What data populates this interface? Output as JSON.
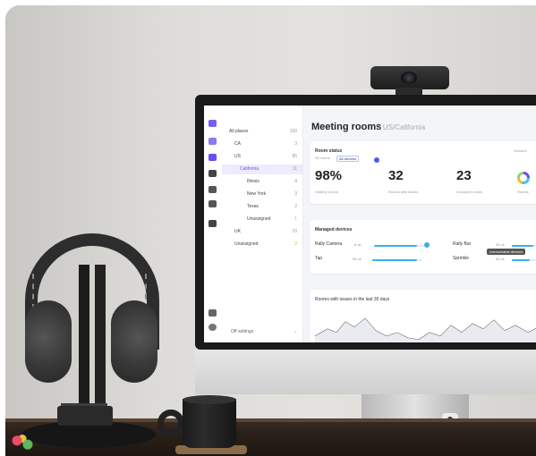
{
  "screen": {
    "page_title": "Meeting rooms",
    "page_location": "- US/California",
    "tree": [
      {
        "label": "All places",
        "count": "100",
        "level": 0
      },
      {
        "label": "CA",
        "count": "3",
        "level": 1
      },
      {
        "label": "US",
        "count": "85",
        "level": 1
      },
      {
        "label": "California",
        "count": "11",
        "level": 2
      },
      {
        "label": "Illinois",
        "count": "4",
        "level": 3
      },
      {
        "label": "New York",
        "count": "3",
        "level": 3
      },
      {
        "label": "Texas",
        "count": "2",
        "level": 3
      },
      {
        "label": "Unassigned",
        "count": "1",
        "level": 3
      },
      {
        "label": "UK",
        "count": "10",
        "level": 1
      },
      {
        "label": "Unassigned",
        "count": "2",
        "level": 1
      }
    ],
    "footer_link": "Off settings",
    "room_status": {
      "title": "Room status",
      "subtitle": "All rooms",
      "tooltip": "All devices",
      "side_label": "Sensors",
      "stats": [
        {
          "value": "98%",
          "label": "Healthy rooms"
        },
        {
          "value": "32",
          "label": "Rooms with issues"
        },
        {
          "value": "23",
          "label": "Occupied rooms"
        }
      ],
      "donut_label": "Rooms"
    },
    "managed_devices": {
      "title": "Managed devices",
      "devices": [
        {
          "name": "Rally Camera",
          "value": "8 ok",
          "fill": 0.85,
          "color": "#3ab0e8"
        },
        {
          "name": "Tap",
          "value": "55 ok",
          "fill": 0.9,
          "color": "#3ab0e8"
        },
        {
          "name": "Rally Bar",
          "value": "55 ok",
          "fill": 0.7,
          "color": "#3ab0e8"
        },
        {
          "name": "Sprinkle",
          "value": "55 ok",
          "fill": 0.6,
          "color": "#3ab0e8"
        }
      ],
      "tooltip": "Unreachable devices"
    },
    "chart": {
      "title": "Rooms with issues in the last 30 days"
    }
  }
}
